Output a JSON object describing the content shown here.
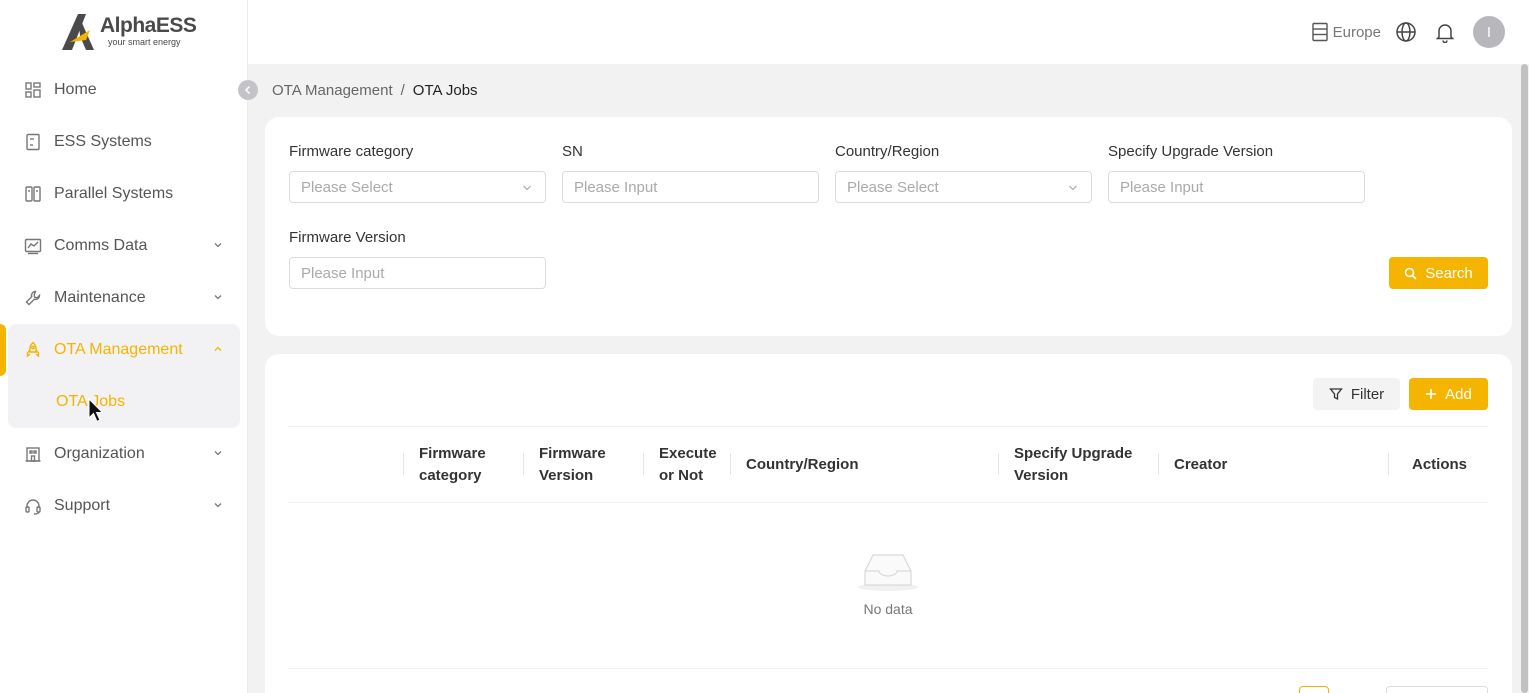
{
  "brand": {
    "name": "AlphaESS",
    "tagline": "your smart energy"
  },
  "sidebar": {
    "items": [
      {
        "label": "Home",
        "icon": "dashboard-icon"
      },
      {
        "label": "ESS Systems",
        "icon": "device-icon"
      },
      {
        "label": "Parallel Systems",
        "icon": "parallel-icon"
      },
      {
        "label": "Comms Data",
        "icon": "chart-icon",
        "expandable": true
      },
      {
        "label": "Maintenance",
        "icon": "wrench-icon",
        "expandable": true
      },
      {
        "label": "OTA Management",
        "icon": "rocket-icon",
        "expandable": true,
        "active": true,
        "children": [
          {
            "label": "OTA Jobs",
            "active": true
          }
        ]
      },
      {
        "label": "Organization",
        "icon": "building-icon",
        "expandable": true
      },
      {
        "label": "Support",
        "icon": "headset-icon",
        "expandable": true
      }
    ]
  },
  "header": {
    "region": "Europe",
    "avatar_initial": "I"
  },
  "breadcrumb": {
    "parent": "OTA Management",
    "separator": "/",
    "current": "OTA Jobs"
  },
  "filters": {
    "firmware_category": {
      "label": "Firmware category",
      "placeholder": "Please Select"
    },
    "sn": {
      "label": "SN",
      "placeholder": "Please Input"
    },
    "country_region": {
      "label": "Country/Region",
      "placeholder": "Please Select"
    },
    "upgrade_version": {
      "label": "Specify Upgrade Version",
      "placeholder": "Please Input"
    },
    "firmware_version": {
      "label": "Firmware Version",
      "placeholder": "Please Input"
    },
    "search_label": "Search"
  },
  "table": {
    "filter_label": "Filter",
    "add_label": "Add",
    "columns": [
      {
        "line1": "Firmware",
        "line2": "category"
      },
      {
        "line1": "Firmware",
        "line2": "Version"
      },
      {
        "line1": "Execute",
        "line2": "or Not"
      },
      {
        "line1": "Country/Region",
        "line2": ""
      },
      {
        "line1": "Specify Upgrade",
        "line2": "Version"
      },
      {
        "line1": "Creator",
        "line2": ""
      },
      {
        "line1": "Actions",
        "line2": ""
      }
    ],
    "empty_text": "No data"
  },
  "colors": {
    "accent": "#f4b400"
  }
}
